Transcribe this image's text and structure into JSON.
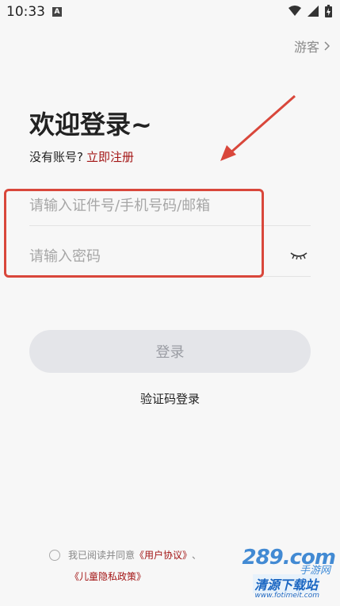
{
  "status_bar": {
    "time": "10:33",
    "app_badge": "A"
  },
  "header": {
    "guest_label": "游客"
  },
  "welcome": {
    "title": "欢迎登录~",
    "no_account": "没有账号?",
    "register_link": "立即注册"
  },
  "form": {
    "account_placeholder": "请输入证件号/手机号码/邮箱",
    "password_placeholder": "请输入密码",
    "login_button": "登录",
    "sms_login": "验证码登录"
  },
  "agreement": {
    "prefix": "我已阅读并同意",
    "user_agreement": "《用户协议》",
    "separator": "、",
    "privacy_policy": "《儿童隐私政策》"
  },
  "watermark": {
    "brand": "289.com",
    "subtitle": "手游网",
    "mid": "清源下载站",
    "url": "www.fotimeit.com"
  },
  "colors": {
    "accent": "#a31515",
    "annotation": "#d9473b",
    "button_bg": "#e4e5e9"
  }
}
